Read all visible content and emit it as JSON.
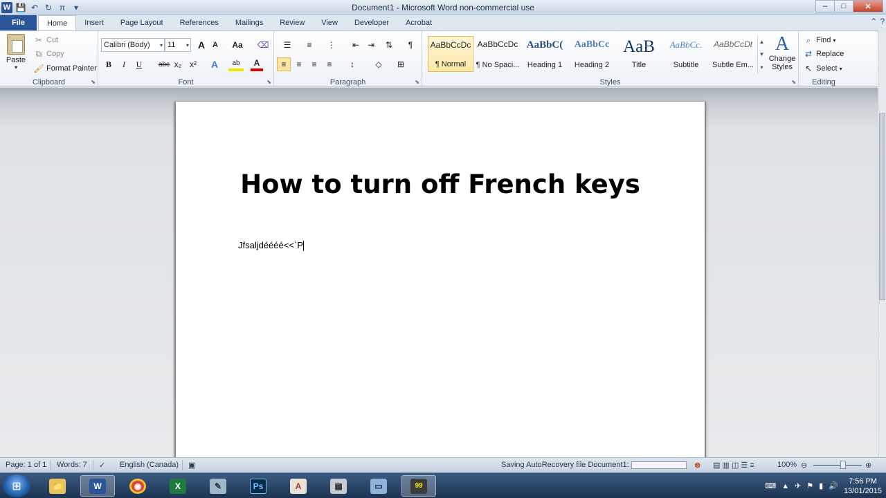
{
  "window": {
    "title": "Document1 - Microsoft Word non-commercial use",
    "controls": {
      "minimize": "–",
      "maximize": "□",
      "close": "✕"
    }
  },
  "quick_access": {
    "app_icon": "W"
  },
  "tabs": [
    {
      "label": "File"
    },
    {
      "label": "Home"
    },
    {
      "label": "Insert"
    },
    {
      "label": "Page Layout"
    },
    {
      "label": "References"
    },
    {
      "label": "Mailings"
    },
    {
      "label": "Review"
    },
    {
      "label": "View"
    },
    {
      "label": "Developer"
    },
    {
      "label": "Acrobat"
    }
  ],
  "clipboard": {
    "label": "Clipboard",
    "paste": "Paste",
    "cut": "Cut",
    "copy": "Copy",
    "format_painter": "Format Painter"
  },
  "font": {
    "label": "Font",
    "family": "Calibri (Body)",
    "size": "11",
    "grow": "A",
    "shrink": "A",
    "change_case": "Aa",
    "bold": "B",
    "italic": "I",
    "underline": "U",
    "strikethrough": "abc",
    "subscript": "x₂",
    "superscript": "x²",
    "effects": "A",
    "highlight": "ab",
    "font_color": "A",
    "accent_highlight": "#f2e600",
    "accent_font_color": "#e00000"
  },
  "paragraph": {
    "label": "Paragraph",
    "pilcrow": "¶"
  },
  "styles": {
    "label": "Styles",
    "items": [
      {
        "preview": "AaBbCcDc",
        "name": "¶ Normal"
      },
      {
        "preview": "AaBbCcDc",
        "name": "¶ No Spaci..."
      },
      {
        "preview": "AaBbC(",
        "name": "Heading 1"
      },
      {
        "preview": "AaBbCc",
        "name": "Heading 2"
      },
      {
        "preview": "AaB",
        "name": "Title"
      },
      {
        "preview": "AaBbCc.",
        "name": "Subtitle"
      },
      {
        "preview": "AaBbCcDt",
        "name": "Subtle Em..."
      }
    ],
    "change_styles": "Change Styles"
  },
  "editing": {
    "label": "Editing",
    "find": "Find",
    "replace": "Replace",
    "select": "Select"
  },
  "document": {
    "heading": "How to turn off French keys",
    "body": "Jfsaljdéééé<<`P"
  },
  "status": {
    "page": "Page: 1 of 1",
    "words": "Words: 7",
    "language": "English (Canada)",
    "saving": "Saving AutoRecovery file Document1:",
    "save_progress_pct": 0,
    "zoom": "100%"
  },
  "taskbar": {
    "apps": [
      {
        "name": "File Explorer",
        "glyph": "📁"
      },
      {
        "name": "Microsoft Word",
        "glyph": "W"
      },
      {
        "name": "Google Chrome",
        "glyph": "◉"
      },
      {
        "name": "Microsoft Excel",
        "glyph": "X"
      },
      {
        "name": "Notepad",
        "glyph": "✎"
      },
      {
        "name": "Photoshop",
        "glyph": "Ps"
      },
      {
        "name": "Access",
        "glyph": "A"
      },
      {
        "name": "Calculator",
        "glyph": "▦"
      },
      {
        "name": "Screen Capture",
        "glyph": "▭"
      },
      {
        "name": "Sound Recorder",
        "glyph": "99"
      }
    ],
    "time": "7:56 PM",
    "date": "13/01/2015"
  }
}
